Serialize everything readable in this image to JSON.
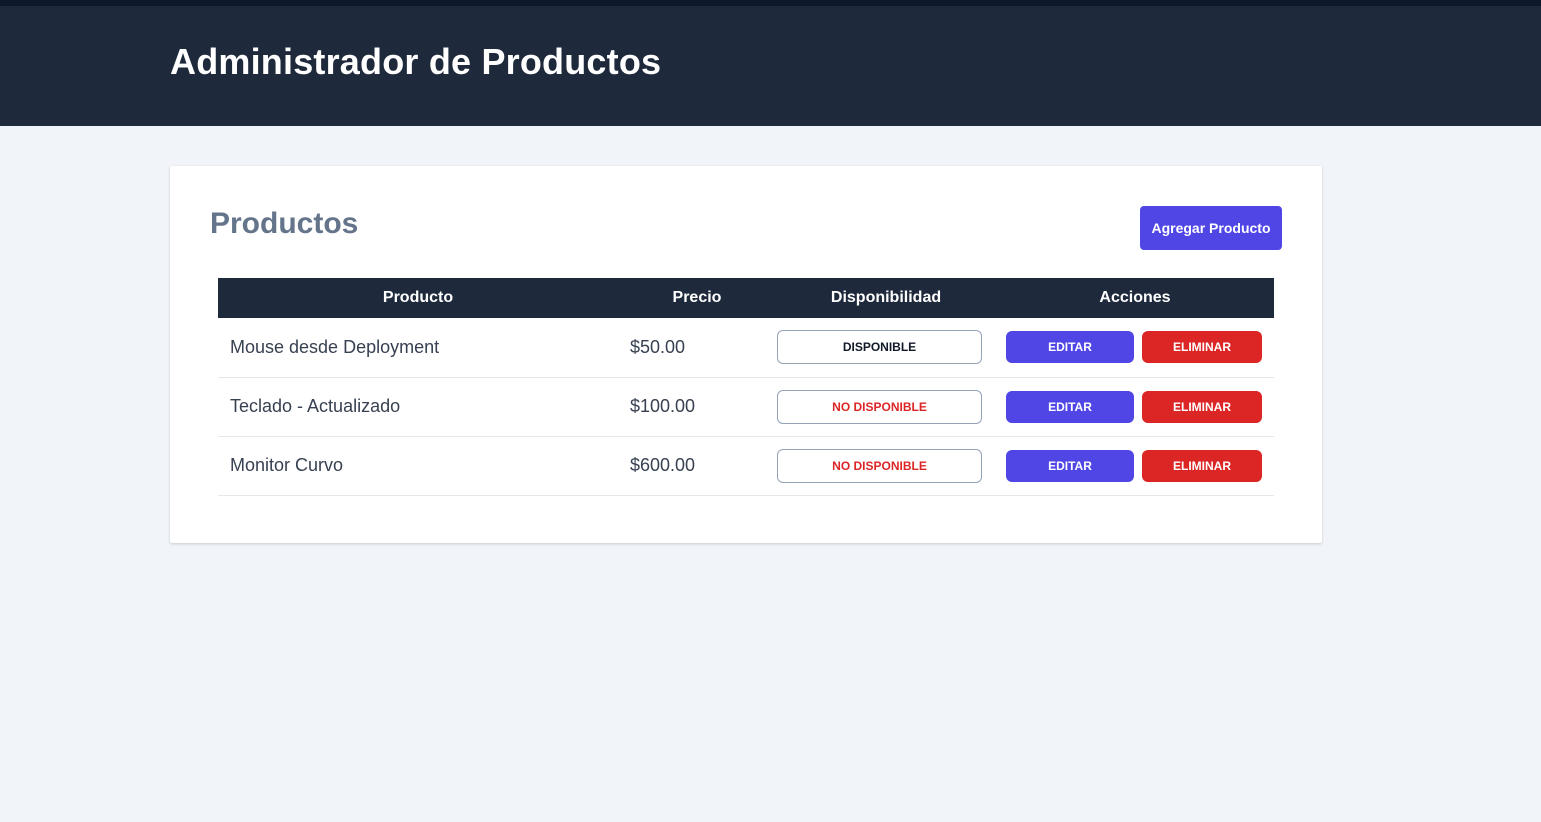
{
  "header": {
    "title": "Administrador de Productos"
  },
  "card": {
    "title": "Productos",
    "add_button": "Agregar Producto"
  },
  "table": {
    "columns": [
      "Producto",
      "Precio",
      "Disponibilidad",
      "Acciones"
    ],
    "rows": [
      {
        "name": "Mouse desde Deployment",
        "price": "$50.00",
        "availability": "Disponible",
        "available": true,
        "edit": "Editar",
        "delete": "Eliminar"
      },
      {
        "name": "Teclado - Actualizado",
        "price": "$100.00",
        "availability": "No Disponible",
        "available": false,
        "edit": "Editar",
        "delete": "Eliminar"
      },
      {
        "name": "Monitor Curvo",
        "price": "$600.00",
        "availability": "No Disponible",
        "available": false,
        "edit": "Editar",
        "delete": "Eliminar"
      }
    ]
  },
  "colors": {
    "header_bg": "#1e293b",
    "primary": "#4f46e5",
    "danger": "#dc2626",
    "page_bg": "#f1f5f9"
  }
}
